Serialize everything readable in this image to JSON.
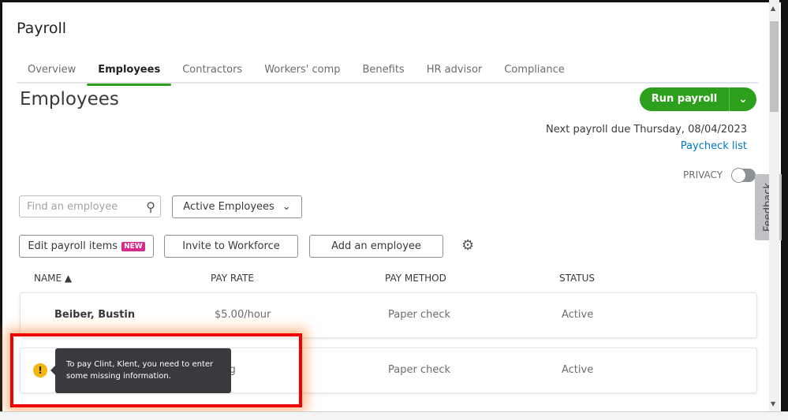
{
  "app": {
    "title": "Payroll"
  },
  "tabs": [
    {
      "label": "Overview",
      "active": false
    },
    {
      "label": "Employees",
      "active": true
    },
    {
      "label": "Contractors",
      "active": false
    },
    {
      "label": "Workers' comp",
      "active": false
    },
    {
      "label": "Benefits",
      "active": false
    },
    {
      "label": "HR advisor",
      "active": false
    },
    {
      "label": "Compliance",
      "active": false
    }
  ],
  "page": {
    "heading": "Employees"
  },
  "run_payroll": {
    "label": "Run payroll",
    "caret_icon": "chevron-down-icon"
  },
  "next_payroll": "Next payroll due Thursday, 08/04/2023",
  "paycheck_list": "Paycheck list",
  "privacy": {
    "label": "PRIVACY",
    "on": false
  },
  "feedback": "Feedback",
  "search": {
    "placeholder": "Find an employee",
    "value": ""
  },
  "filter": {
    "selected": "Active Employees"
  },
  "buttons": {
    "edit_payroll_items": "Edit payroll items",
    "new_badge": "NEW",
    "invite": "Invite to Workforce",
    "add_employee": "Add an employee"
  },
  "table": {
    "headers": [
      "NAME ▲",
      "PAY RATE",
      "PAY METHOD",
      "STATUS"
    ],
    "rows": [
      {
        "name": "Beiber, Bustin",
        "pay_rate": "$5.00/hour",
        "pay_method": "Paper check",
        "status": "Active"
      },
      {
        "name": "",
        "pay_rate": "sing",
        "pay_method": "Paper check",
        "status": "Active",
        "warning": true
      }
    ]
  },
  "tooltip": {
    "text": "To pay Clint, Klent, you need to enter some missing information."
  },
  "colors": {
    "accent": "#2ca01c",
    "link": "#0077c5",
    "badge": "#d52b8a",
    "warning": "#f3b610",
    "highlight": "#f20000"
  }
}
